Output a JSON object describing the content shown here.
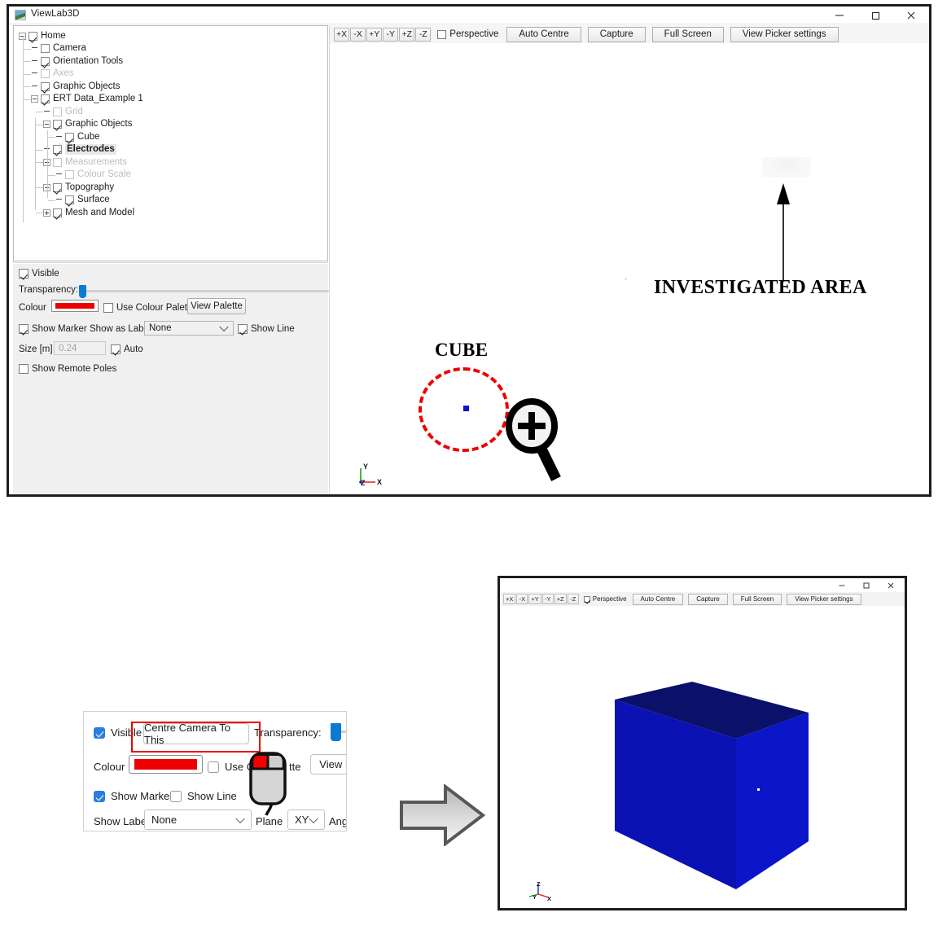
{
  "top_window": {
    "title": "ViewLab3D",
    "icon": "app-icon",
    "controls": {
      "minimize": "minimize-icon",
      "maximize": "maximize-icon",
      "close": "close-icon"
    },
    "tree": {
      "nodes": [
        {
          "label": "Home",
          "indent": 0,
          "checked": true,
          "expander": "minus",
          "dim": false,
          "selected": false
        },
        {
          "label": "Camera",
          "indent": 1,
          "checked": false,
          "expander": "none",
          "dim": false,
          "selected": false
        },
        {
          "label": "Orientation Tools",
          "indent": 1,
          "checked": true,
          "expander": "none",
          "dim": false,
          "selected": false
        },
        {
          "label": "Axes",
          "indent": 1,
          "checked": false,
          "expander": "none",
          "dim": true,
          "selected": false
        },
        {
          "label": "Graphic Objects",
          "indent": 1,
          "checked": true,
          "expander": "none",
          "dim": false,
          "selected": false
        },
        {
          "label": "ERT Data_Example 1",
          "indent": 1,
          "checked": true,
          "expander": "minus",
          "dim": false,
          "selected": false
        },
        {
          "label": "Grid",
          "indent": 2,
          "checked": false,
          "expander": "none",
          "dim": true,
          "selected": false
        },
        {
          "label": "Graphic Objects",
          "indent": 2,
          "checked": true,
          "expander": "minus",
          "dim": false,
          "selected": false
        },
        {
          "label": "Cube",
          "indent": 3,
          "checked": true,
          "expander": "none",
          "dim": false,
          "selected": false
        },
        {
          "label": "Electrodes",
          "indent": 2,
          "checked": true,
          "expander": "none",
          "dim": false,
          "selected": true
        },
        {
          "label": "Measurements",
          "indent": 2,
          "checked": false,
          "expander": "minus",
          "dim": true,
          "selected": false
        },
        {
          "label": "Colour Scale",
          "indent": 3,
          "checked": false,
          "expander": "none",
          "dim": true,
          "selected": false
        },
        {
          "label": "Topography",
          "indent": 2,
          "checked": true,
          "expander": "minus",
          "dim": false,
          "selected": false
        },
        {
          "label": "Surface",
          "indent": 3,
          "checked": true,
          "expander": "none",
          "dim": false,
          "selected": false
        },
        {
          "label": "Mesh and Model",
          "indent": 2,
          "checked": true,
          "expander": "plus",
          "dim": false,
          "selected": false
        }
      ]
    },
    "properties": {
      "visible_label": "Visible",
      "visible_checked": true,
      "transparency_label": "Transparency:",
      "transparency_value": 2,
      "colour_label": "Colour",
      "colour_value": "#ef0000",
      "use_colour_palette_label": "Use Colour Palette",
      "use_colour_palette_checked": false,
      "view_palette_label": "View Palette",
      "show_marker_label": "Show Marker",
      "show_marker_checked": true,
      "show_as_label_label": "Show as Label",
      "show_as_label_value": "None",
      "show_line_label": "Show Line",
      "show_line_checked": true,
      "size_label": "Size [m]",
      "size_value": "0.24",
      "auto_label": "Auto",
      "auto_checked": true,
      "show_remote_poles_label": "Show Remote Poles",
      "show_remote_poles_checked": false
    },
    "toolbar": {
      "axis_buttons": [
        "+X",
        "-X",
        "+Y",
        "-Y",
        "+Z",
        "-Z"
      ],
      "perspective_label": "Perspective",
      "perspective_checked": false,
      "buttons": [
        "Auto Centre",
        "Capture",
        "Full Screen",
        "View Picker settings"
      ]
    },
    "annotations": {
      "investigated_area": "INVESTIGATED AREA",
      "cube": "CUBE",
      "arrow_icon": "up-arrow-annotation",
      "magnifier_icon": "magnifier-plus-icon",
      "highlight_circle_colour": "#ee0000",
      "marker_colour": "#0a12d6"
    },
    "axis_widget": {
      "x": "X",
      "y": "Y",
      "z": "Z"
    }
  },
  "popup_panel": {
    "visible_label": "Visible",
    "visible_checked": true,
    "centre_camera_label": "Centre Camera To This",
    "transparency_label": "Transparency:",
    "colour_label": "Colour",
    "colour_value": "#ef0000",
    "use_colour_palette_label": "Use C",
    "use_colour_palette_label_tail": "tte",
    "use_colour_palette_checked": false,
    "view_palette_label": "View Pa",
    "show_marker_label": "Show Marker",
    "show_marker_checked": true,
    "show_line_label": "Show Line",
    "show_line_checked": false,
    "show_label_label": "Show Label",
    "show_label_value": "None",
    "plane_label": "Plane",
    "plane_value": "XY",
    "angle_label": "Angl",
    "highlight_colour": "#ee0000",
    "mouse_icon": "mouse-left-click-icon"
  },
  "transition_arrow": {
    "icon": "right-block-arrow-icon"
  },
  "bottom_window": {
    "controls": {
      "minimize": "minimize-icon",
      "maximize": "maximize-icon",
      "close": "close-icon"
    },
    "toolbar": {
      "axis_buttons": [
        "+X",
        "-X",
        "+Y",
        "-Y",
        "+Z",
        "-Z"
      ],
      "perspective_label": "Perspective",
      "perspective_checked": true,
      "buttons": [
        "Auto Centre",
        "Capture",
        "Full Screen",
        "View Picker settings"
      ]
    },
    "scene": {
      "object_name": "Cube",
      "face_front_colour": "#0b16c9",
      "face_left_colour": "#0a12b4",
      "face_top_colour": "#0b1168",
      "marker_colour": "#ffffff"
    },
    "axis_widget": {
      "x": "X",
      "y": "Y",
      "z": "Z"
    }
  }
}
